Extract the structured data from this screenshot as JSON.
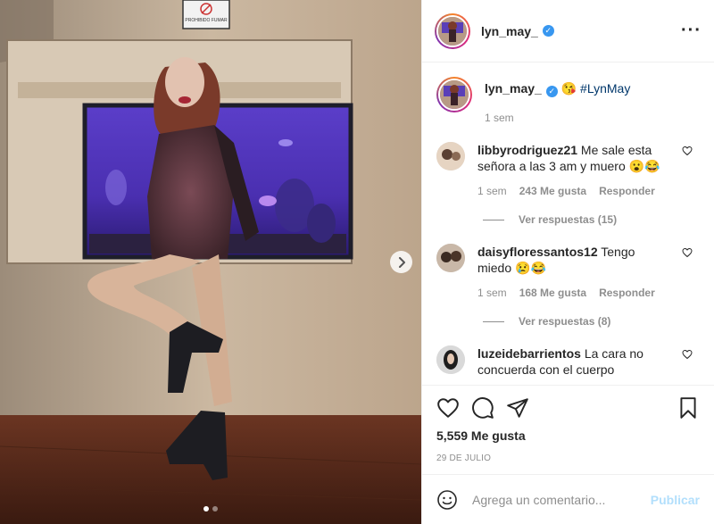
{
  "post": {
    "author": "lyn_may_",
    "caption": {
      "username": "lyn_may_",
      "text": "😘 #LynMay",
      "time": "1 sem"
    },
    "comments": [
      {
        "username": "libbyrodriguez21",
        "text": "Me sale esta señora a las 3 am y muero 😮😂",
        "time": "1 sem",
        "likes": "243 Me gusta",
        "reply": "Responder",
        "view_replies": "Ver respuestas (15)"
      },
      {
        "username": "daisyfloressantos12",
        "text": "Tengo miedo 😢😂",
        "time": "1 sem",
        "likes": "168 Me gusta",
        "reply": "Responder",
        "view_replies": "Ver respuestas (8)"
      },
      {
        "username": "luzeidebarrientos",
        "text": "La cara no concuerda con el cuerpo"
      }
    ],
    "likes_count": "5,559 Me gusta",
    "date": "29 DE JULIO",
    "comment_placeholder": "Agrega un comentario...",
    "publish_label": "Publicar",
    "sign_text": "PROHIBIDO FUMAR",
    "carousel": {
      "total": 2,
      "active": 1
    }
  },
  "colors": {
    "verified": "#3897f0",
    "link": "#00376b",
    "publish_disabled": "#b2dffc",
    "muted": "#8e8e8e"
  }
}
